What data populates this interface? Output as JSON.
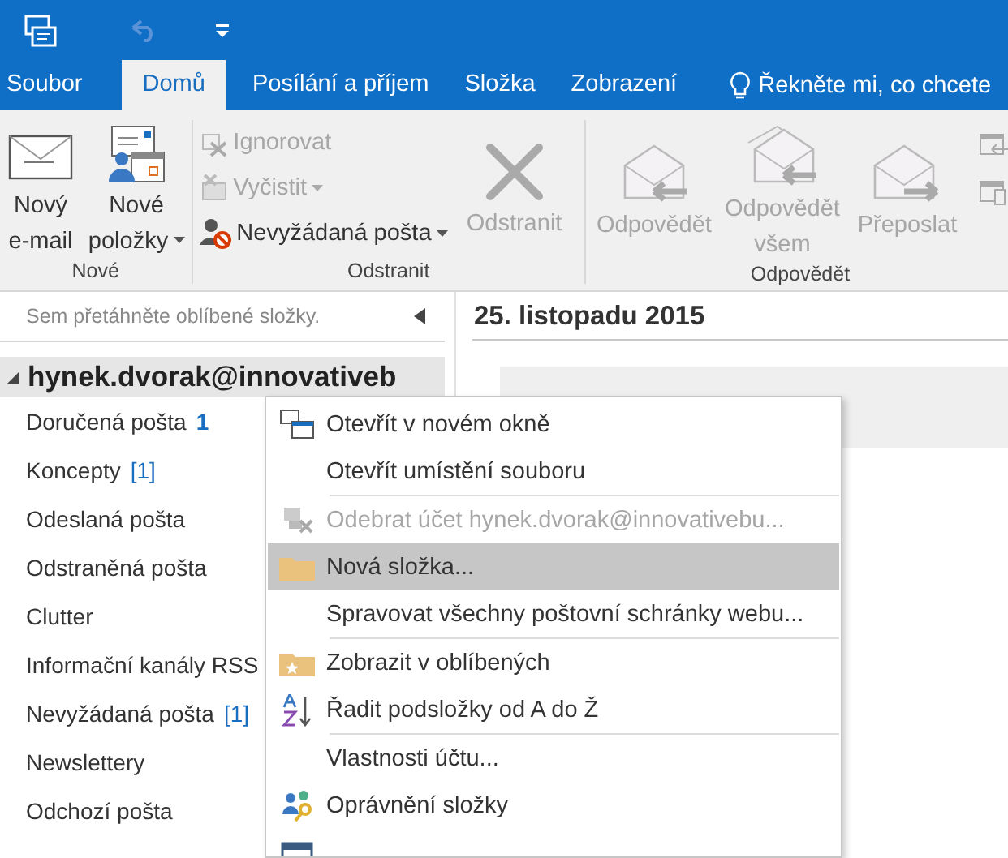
{
  "tabs": [
    {
      "label": "Soubor",
      "selected": false
    },
    {
      "label": "Domů",
      "selected": true
    },
    {
      "label": "Posílání a příjem",
      "selected": false
    },
    {
      "label": "Složka",
      "selected": false
    },
    {
      "label": "Zobrazení",
      "selected": false
    }
  ],
  "tell_me": "Řekněte mi, co chcete",
  "ribbon": {
    "groups": [
      {
        "label": "Nové",
        "items": [
          {
            "kind": "large",
            "label": "Nový\ne-mail",
            "disabled": false,
            "dropdown": false
          },
          {
            "kind": "large",
            "label": "Nové\npoložky",
            "disabled": false,
            "dropdown": true
          }
        ]
      },
      {
        "label": "Odstranit",
        "items": [
          {
            "kind": "small",
            "label": "Ignorovat",
            "disabled": true,
            "dropdown": false
          },
          {
            "kind": "small",
            "label": "Vyčistit",
            "disabled": true,
            "dropdown": true
          },
          {
            "kind": "small",
            "label": "Nevyžádaná pošta",
            "disabled": false,
            "dropdown": true
          },
          {
            "kind": "large",
            "label": "Odstranit",
            "disabled": true,
            "dropdown": false
          }
        ]
      },
      {
        "label": "Odpovědět",
        "items": [
          {
            "kind": "large",
            "label": "Odpovědět",
            "disabled": true,
            "dropdown": false
          },
          {
            "kind": "large",
            "label": "Odpovědět\nvšem",
            "disabled": true,
            "dropdown": false
          },
          {
            "kind": "large",
            "label": "Přeposlat",
            "disabled": true,
            "dropdown": false
          },
          {
            "kind": "icons",
            "disabled": true
          }
        ]
      }
    ]
  },
  "sidebar": {
    "favorites_hint": "Sem přetáhněte oblíbené složky.",
    "account": {
      "name": "hynek.dvorak@innovativeb",
      "expanded": true
    },
    "folders": [
      {
        "name": "Doručená pošta",
        "count": "1",
        "unread": true
      },
      {
        "name": "Koncepty",
        "count": "[1]",
        "unread": false
      },
      {
        "name": "Odeslaná pošta"
      },
      {
        "name": "Odstraněná pošta"
      },
      {
        "name": "Clutter"
      },
      {
        "name": "Informační kanály RSS"
      },
      {
        "name": "Nevyžádaná pošta",
        "count": "[1]",
        "unread": false
      },
      {
        "name": "Newslettery"
      },
      {
        "name": "Odchozí pošta"
      }
    ]
  },
  "content": {
    "date": "25. listopadu 2015"
  },
  "context_menu": {
    "items": [
      {
        "label": "Otevřít v novém okně",
        "disabled": false,
        "selected": false,
        "separator_after": false
      },
      {
        "label": "Otevřít umístění souboru",
        "disabled": false,
        "selected": false,
        "separator_after": true
      },
      {
        "label": "Odebrat účet hynek.dvorak@innovativebu...",
        "disabled": true,
        "selected": false,
        "separator_after": false
      },
      {
        "label": "Nová složka...",
        "disabled": false,
        "selected": true,
        "separator_after": false
      },
      {
        "label": "Spravovat všechny poštovní schránky webu...",
        "disabled": false,
        "selected": false,
        "separator_after": true
      },
      {
        "label": "Zobrazit v oblíbených",
        "disabled": false,
        "selected": false,
        "separator_after": false
      },
      {
        "label": "Řadit podsložky od A do Ž",
        "disabled": false,
        "selected": false,
        "separator_after": true
      },
      {
        "label": "Vlastnosti účtu...",
        "disabled": false,
        "selected": false,
        "separator_after": false
      },
      {
        "label": "Oprávnění složky",
        "disabled": false,
        "selected": false,
        "separator_after": false
      }
    ]
  }
}
